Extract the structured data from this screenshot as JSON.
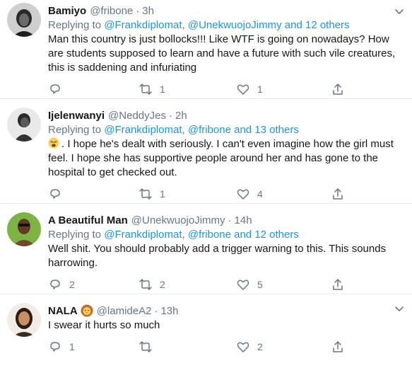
{
  "tweets": [
    {
      "name": "Bamiyo",
      "handle": "@fribone",
      "sep": "·",
      "time": "3h",
      "replying_prefix": "Replying to",
      "replying_users": [
        "@Frankdiplomat",
        "@UnekwuojoJimmy"
      ],
      "replying_and": "and",
      "replying_others": "12 others",
      "body": "Man this country is just bollocks!!! Like WTF is going on nowadays? How are students supposed to learn and have a future with such vile creatures, this is saddening and infuriating",
      "reply_count": "",
      "retweet_count": "1",
      "like_count": "1"
    },
    {
      "name": "Ijelenwanyi",
      "handle": "@NeddyJes",
      "sep": "·",
      "time": "2h",
      "replying_prefix": "Replying to",
      "replying_users": [
        "@Frankdiplomat",
        "@fribone"
      ],
      "replying_and": "and",
      "replying_others": "13 others",
      "body": ". I hope he's dealt with seriously. I can't even imagine how the girl must feel. I hope she has supportive people around her and has gone to the hospital to get checked out.",
      "body_emoji": "weary-face-emoji",
      "reply_count": "",
      "retweet_count": "1",
      "like_count": "4"
    },
    {
      "name": "A Beautiful Man",
      "handle": "@UnekwuojoJimmy",
      "sep": "·",
      "time": "14h",
      "replying_prefix": "Replying to",
      "replying_users": [
        "@Frankdiplomat",
        "@fribone"
      ],
      "replying_and": "and",
      "replying_others": "12 others",
      "body": "Well shit. You should probably add a trigger warning to this. This sounds harrowing.",
      "reply_count": "2",
      "retweet_count": "2",
      "like_count": "5"
    },
    {
      "name": "NALA",
      "name_emoji": "lion-emoji",
      "handle": "@lamideA2",
      "sep": "·",
      "time": "13h",
      "body": "I swear it hurts so much",
      "reply_count": "1",
      "retweet_count": "",
      "like_count": "2"
    }
  ],
  "colors": {
    "link": "#1b95e0",
    "secondary_text": "#657786",
    "divider": "#e6ecf0"
  }
}
